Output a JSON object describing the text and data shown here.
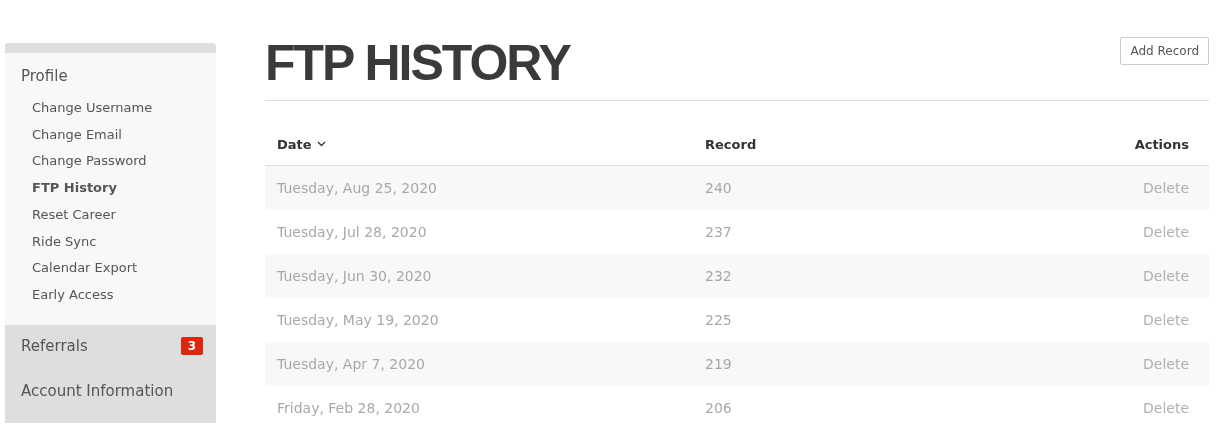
{
  "sidebar": {
    "section": "Profile",
    "items": [
      {
        "label": "Change Username",
        "selected": false
      },
      {
        "label": "Change Email",
        "selected": false
      },
      {
        "label": "Change Password",
        "selected": false
      },
      {
        "label": "FTP History",
        "selected": true
      },
      {
        "label": "Reset Career",
        "selected": false
      },
      {
        "label": "Ride Sync",
        "selected": false
      },
      {
        "label": "Calendar Export",
        "selected": false
      },
      {
        "label": "Early Access",
        "selected": false
      }
    ],
    "links": [
      {
        "label": "Referrals",
        "badge": "3"
      },
      {
        "label": "Account Information"
      }
    ]
  },
  "page": {
    "title": "FTP HISTORY",
    "add_button": "Add Record"
  },
  "table": {
    "columns": [
      {
        "label": "Date",
        "sorted": true
      },
      {
        "label": "Record",
        "sorted": false
      },
      {
        "label": "Actions",
        "sorted": false
      }
    ],
    "rows": [
      {
        "date": "Tuesday, Aug 25, 2020",
        "record": "240",
        "action": "Delete"
      },
      {
        "date": "Tuesday, Jul 28, 2020",
        "record": "237",
        "action": "Delete"
      },
      {
        "date": "Tuesday, Jun 30, 2020",
        "record": "232",
        "action": "Delete"
      },
      {
        "date": "Tuesday, May 19, 2020",
        "record": "225",
        "action": "Delete"
      },
      {
        "date": "Tuesday, Apr 7, 2020",
        "record": "219",
        "action": "Delete"
      },
      {
        "date": "Friday, Feb 28, 2020",
        "record": "206",
        "action": "Delete"
      }
    ]
  }
}
